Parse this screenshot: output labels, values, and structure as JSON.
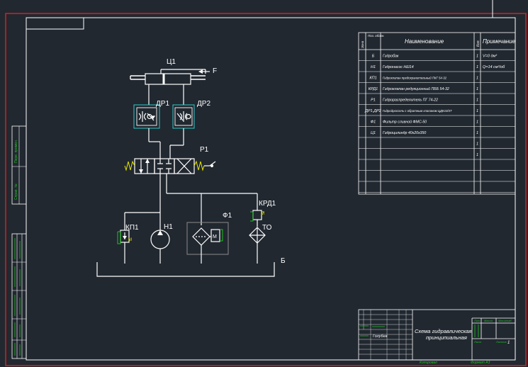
{
  "colors": {
    "background": "#212830",
    "frame_red": "#d42020",
    "lines": "#ffffff",
    "yellow": "#e6e600",
    "cyan": "#30c8c8",
    "green": "#20c020",
    "gray": "#8a8a8a"
  },
  "diagram": {
    "labels": {
      "cylinder": "Ц1",
      "force": "F",
      "throttle1": "ДР1",
      "throttle2": "ДР2",
      "distributor": "Р1",
      "relief_valve": "КРД1",
      "safety_valve": "КП1",
      "pump": "Н1",
      "filter": "Ф1",
      "cooler": "ТО",
      "tank": "Б",
      "m_mark": "М"
    }
  },
  "spec_table": {
    "headers": [
      "Зона",
      "Поз. обозн.",
      "Наименование",
      "Кол.",
      "Примечание"
    ],
    "rows": [
      {
        "pos": "Б",
        "name": "Гидробак",
        "qty": "1",
        "note": "V=0 дм³"
      },
      {
        "pos": "Н1",
        "name": "Гидронасос НШ14",
        "qty": "1",
        "note": "Q=14 см³/об"
      },
      {
        "pos": "КП1",
        "name": "Гидроклапан предохранительный ПКГ 54-32",
        "qty": "1",
        "note": ""
      },
      {
        "pos": "КРД1",
        "name": "Гидроклапан редукционный ПББ 54-32",
        "qty": "1",
        "note": ""
      },
      {
        "pos": "Р1",
        "name": "Гидрораспределитель ПГ 74-22",
        "qty": "1",
        "note": ""
      },
      {
        "pos": "ДР1,ДР2",
        "name": "Гидродроссель с обратным клапаном ЦДК10/3Т",
        "qty": "1",
        "note": ""
      },
      {
        "pos": "Ф1",
        "name": "Фильтр сливной ФМС-50",
        "qty": "1",
        "note": ""
      },
      {
        "pos": "Ц1",
        "name": "Гидроцилиндр 40x20x350",
        "qty": "1",
        "note": ""
      },
      {
        "pos": "",
        "name": "",
        "qty": "1",
        "note": ""
      },
      {
        "pos": "",
        "name": "",
        "qty": "1",
        "note": ""
      }
    ]
  },
  "title_block": {
    "title_line1": "Схема гидравлическая",
    "title_line2": "принципиальная",
    "designer": "Голубев",
    "col_lit": "Лит.",
    "col_mass": "Масса",
    "col_scale": "Масштаб",
    "sheet_label": "Лист",
    "sheets_label": "Листов",
    "sheets_count": "1",
    "copy_label": "Копировал",
    "format_label": "Формат А3"
  },
  "side_stamp": {
    "perv_primen": "Перв. примен.",
    "sprav": "Справ. №"
  }
}
